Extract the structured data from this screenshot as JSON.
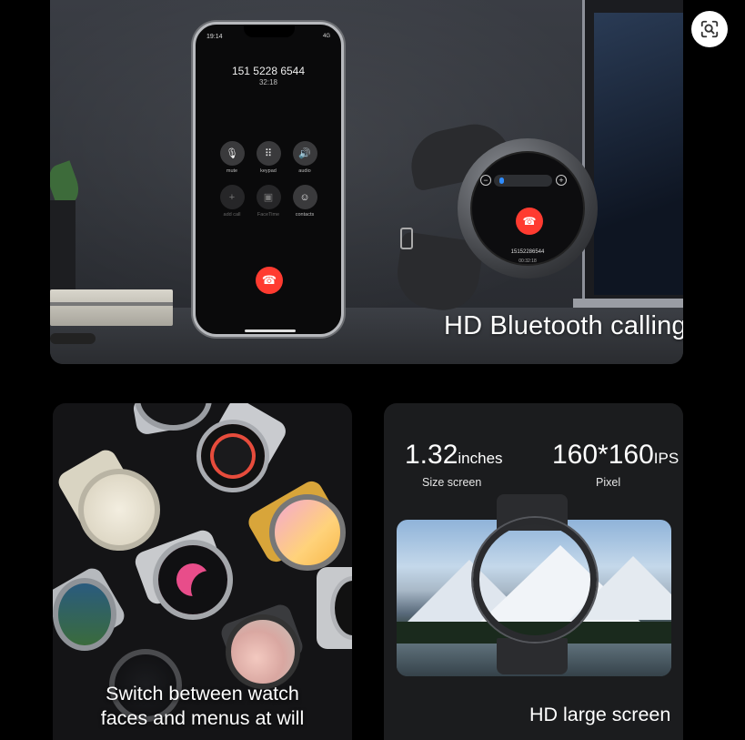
{
  "top_banner": {
    "caption": "HD Bluetooth calling",
    "phone": {
      "status_time": "19:14",
      "status_icons": "4G",
      "number": "151 5228 6544",
      "duration": "32:18",
      "buttons": [
        {
          "label": "mute",
          "icon": "mic-off-icon",
          "glyph": "🎙",
          "dim": false
        },
        {
          "label": "keypad",
          "icon": "keypad-icon",
          "glyph": "⠿",
          "dim": false
        },
        {
          "label": "audio",
          "icon": "speaker-icon",
          "glyph": "🔊",
          "dim": false
        },
        {
          "label": "add call",
          "icon": "plus-icon",
          "glyph": "+",
          "dim": true
        },
        {
          "label": "FaceTime",
          "icon": "facetime-icon",
          "glyph": "▣",
          "dim": true
        },
        {
          "label": "contacts",
          "icon": "contacts-icon",
          "glyph": "☺",
          "dim": false
        }
      ],
      "end_call_glyph": "☎"
    },
    "watch": {
      "number": "15152286544",
      "duration": "00:32:18",
      "volume_minus": "−",
      "volume_plus": "+",
      "end_call_glyph": "☎"
    }
  },
  "bottom_left": {
    "caption_line1": "Switch between watch",
    "caption_line2": "faces and menus at will"
  },
  "bottom_right": {
    "size_value": "1.32",
    "size_unit": "inches",
    "size_label": "Size screen",
    "pixel_value": "160*160",
    "pixel_unit": "IPS",
    "pixel_label": "Pixel",
    "caption": "HD large screen"
  },
  "colors": {
    "background": "#000000",
    "end_call_red": "#ff3b30",
    "volume_blue": "#2f8cff"
  }
}
